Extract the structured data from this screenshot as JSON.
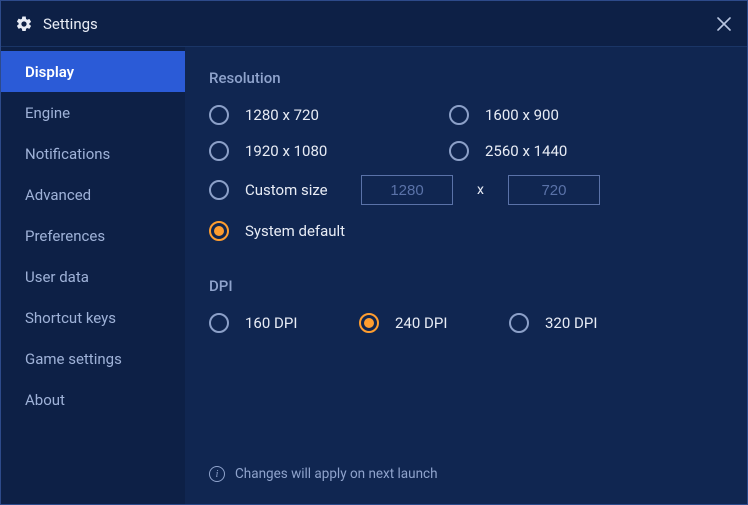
{
  "titlebar": {
    "title": "Settings"
  },
  "sidebar": {
    "items": [
      {
        "label": "Display",
        "active": true
      },
      {
        "label": "Engine",
        "active": false
      },
      {
        "label": "Notifications",
        "active": false
      },
      {
        "label": "Advanced",
        "active": false
      },
      {
        "label": "Preferences",
        "active": false
      },
      {
        "label": "User data",
        "active": false
      },
      {
        "label": "Shortcut keys",
        "active": false
      },
      {
        "label": "Game settings",
        "active": false
      },
      {
        "label": "About",
        "active": false
      }
    ]
  },
  "content": {
    "resolution": {
      "title": "Resolution",
      "options": [
        {
          "label": "1280 x 720",
          "selected": false
        },
        {
          "label": "1600 x 900",
          "selected": false
        },
        {
          "label": "1920 x 1080",
          "selected": false
        },
        {
          "label": "2560 x 1440",
          "selected": false
        }
      ],
      "custom": {
        "label": "Custom size",
        "selected": false,
        "width_placeholder": "1280",
        "height_placeholder": "720",
        "separator": "x"
      },
      "system_default": {
        "label": "System default",
        "selected": true
      }
    },
    "dpi": {
      "title": "DPI",
      "options": [
        {
          "label": "160 DPI",
          "selected": false
        },
        {
          "label": "240 DPI",
          "selected": true
        },
        {
          "label": "320 DPI",
          "selected": false
        }
      ]
    },
    "footer_note": "Changes will apply on next launch"
  }
}
